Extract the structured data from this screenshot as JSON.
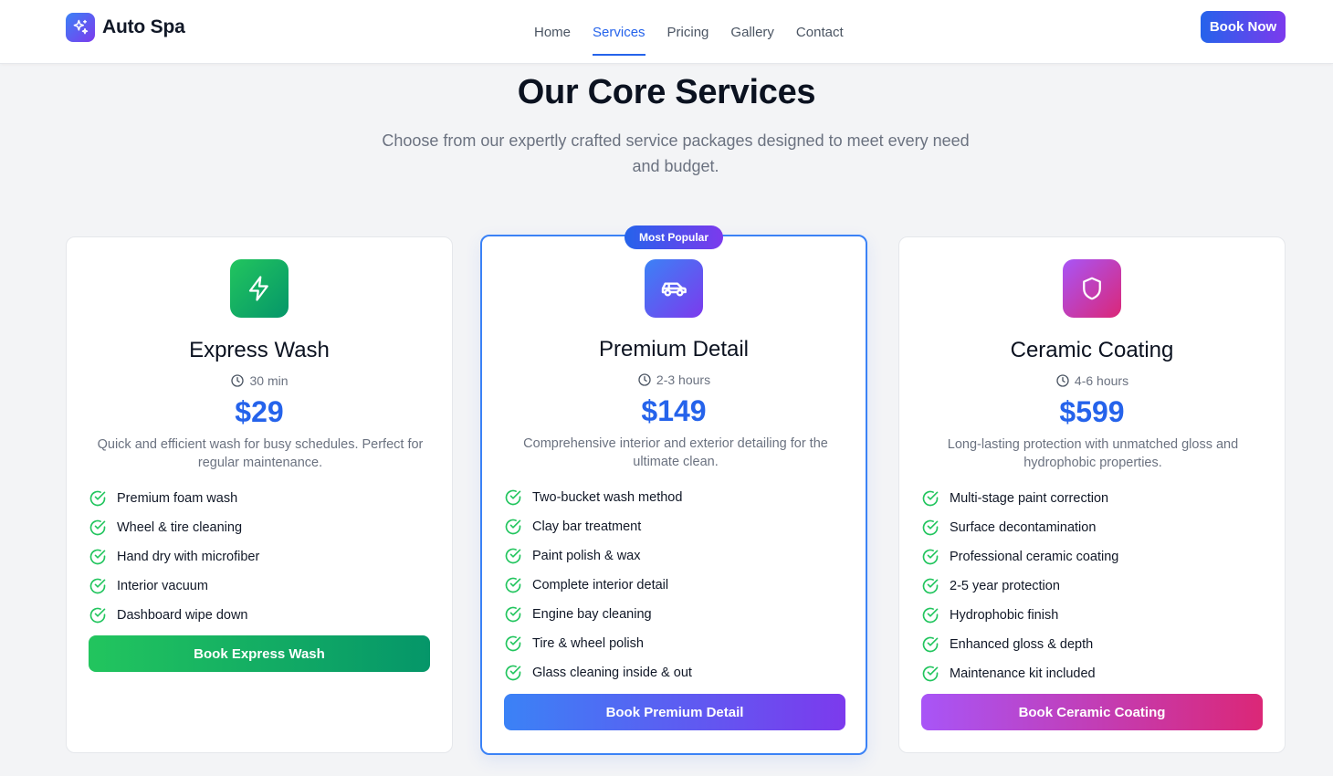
{
  "brand": {
    "name": "Auto Spa"
  },
  "nav": {
    "items": [
      "Home",
      "Services",
      "Pricing",
      "Gallery",
      "Contact"
    ],
    "active": "Services"
  },
  "header": {
    "cta_label": "Book Now"
  },
  "hero": {
    "title": "Our Core Services",
    "subtitle": "Choose from our expertly crafted service packages designed to meet every need and budget."
  },
  "colors": {
    "accent": "#2563eb",
    "check": "#22c55e",
    "express_gradient": [
      "#22c55e",
      "#059669"
    ],
    "premium_gradient": [
      "#3b82f6",
      "#7c3aed"
    ],
    "ceramic_gradient": [
      "#a855f7",
      "#db2777"
    ]
  },
  "cards": [
    {
      "icon": "lightning-icon",
      "title": "Express Wash",
      "duration": "30 min",
      "price": "$29",
      "description": "Quick and efficient wash for busy schedules. Perfect for regular maintenance.",
      "features": [
        "Premium foam wash",
        "Wheel & tire cleaning",
        "Hand dry with microfiber",
        "Interior vacuum",
        "Dashboard wipe down"
      ],
      "button": "Book Express Wash"
    },
    {
      "badge": "Most Popular",
      "icon": "car-icon",
      "title": "Premium Detail",
      "duration": "2-3 hours",
      "price": "$149",
      "description": "Comprehensive interior and exterior detailing for the ultimate clean.",
      "features": [
        "Two-bucket wash method",
        "Clay bar treatment",
        "Paint polish & wax",
        "Complete interior detail",
        "Engine bay cleaning",
        "Tire & wheel polish",
        "Glass cleaning inside & out"
      ],
      "button": "Book Premium Detail"
    },
    {
      "icon": "shield-icon",
      "title": "Ceramic Coating",
      "duration": "4-6 hours",
      "price": "$599",
      "description": "Long-lasting protection with unmatched gloss and hydrophobic properties.",
      "features": [
        "Multi-stage paint correction",
        "Surface decontamination",
        "Professional ceramic coating",
        "2-5 year protection",
        "Hydrophobic finish",
        "Enhanced gloss & depth",
        "Maintenance kit included"
      ],
      "button": "Book Ceramic Coating"
    }
  ]
}
